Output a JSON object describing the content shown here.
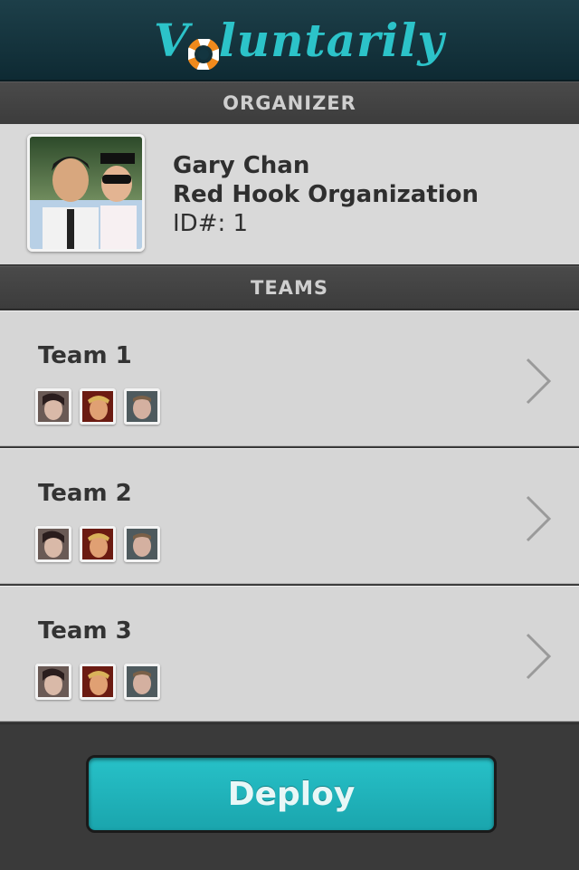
{
  "header": {
    "logo_first": "V",
    "logo_rest": "luntarily"
  },
  "organizer": {
    "section_label": "ORGANIZER",
    "name": "Gary Chan",
    "organization": "Red Hook Organization",
    "id_text": "ID#: 1"
  },
  "teams": {
    "section_label": "TEAMS",
    "items": [
      {
        "name": "Team 1"
      },
      {
        "name": "Team 2"
      },
      {
        "name": "Team 3"
      }
    ]
  },
  "footer": {
    "deploy_label": "Deploy"
  },
  "colors": {
    "brand_accent": "#2cc3c9",
    "deploy_button": "#1fb3bb",
    "header_bg": "#133540"
  }
}
